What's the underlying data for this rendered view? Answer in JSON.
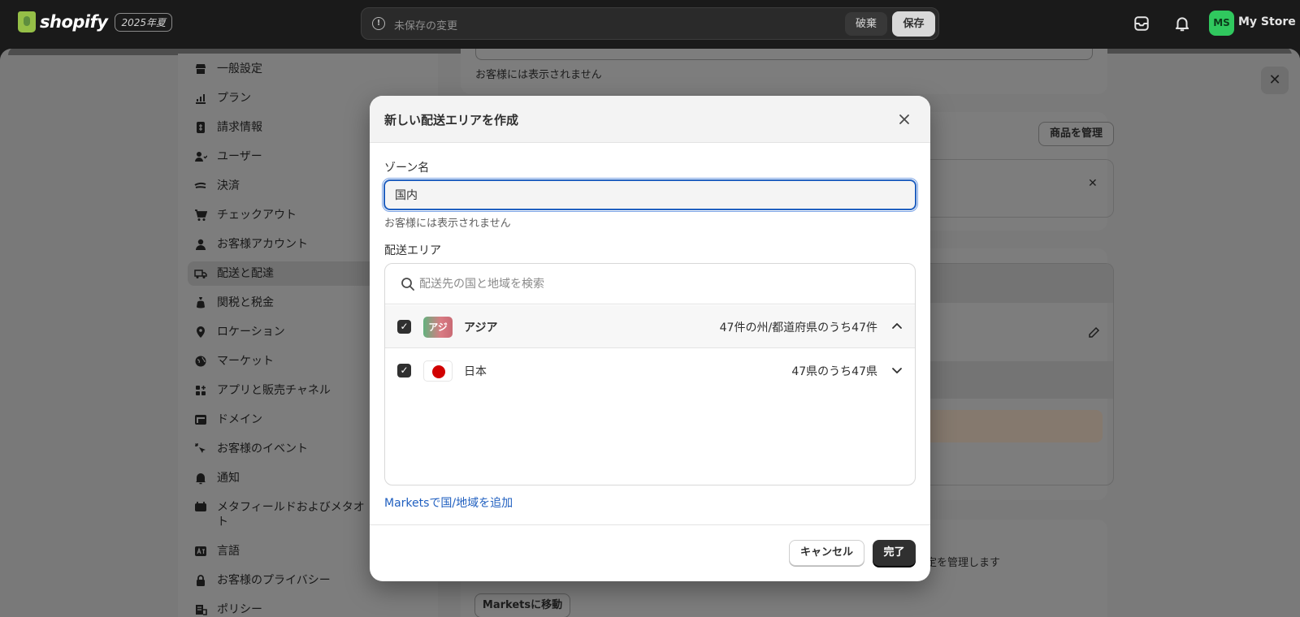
{
  "topbar": {
    "brand": "shopify",
    "season_badge": "2025年夏",
    "unsaved_text": "未保存の変更",
    "discard_label": "破棄",
    "save_label": "保存",
    "avatar_initials": "MS",
    "store_name": "My Store",
    "icons": [
      "shopify-logo-icon",
      "warning-icon",
      "inbox-icon",
      "bell-icon"
    ]
  },
  "sidebar": {
    "items": [
      {
        "label": "一般設定",
        "icon": "store-icon"
      },
      {
        "label": "プラン",
        "icon": "plan-icon"
      },
      {
        "label": "請求情報",
        "icon": "billing-icon"
      },
      {
        "label": "ユーザー",
        "icon": "users-icon"
      },
      {
        "label": "決済",
        "icon": "payments-icon"
      },
      {
        "label": "チェックアウト",
        "icon": "cart-icon"
      },
      {
        "label": "お客様アカウント",
        "icon": "person-icon"
      },
      {
        "label": "配送と配達",
        "icon": "truck-icon",
        "active": true
      },
      {
        "label": "関税と税金",
        "icon": "money-bag-icon"
      },
      {
        "label": "ロケーション",
        "icon": "location-pin-icon"
      },
      {
        "label": "マーケット",
        "icon": "globe-icon"
      },
      {
        "label": "アプリと販売チャネル",
        "icon": "apps-icon"
      },
      {
        "label": "ドメイン",
        "icon": "domain-icon"
      },
      {
        "label": "お客様のイベント",
        "icon": "events-icon"
      },
      {
        "label": "通知",
        "icon": "bell-icon"
      },
      {
        "label": "メタフィールドおよびメタオブジェクト",
        "label_line1": "メタフィールドおよびメタオ",
        "label_line2": "ト",
        "icon": "metafields-icon"
      },
      {
        "label": "言語",
        "icon": "language-icon"
      },
      {
        "label": "お客様のプライバシー",
        "icon": "lock-icon"
      },
      {
        "label": "ポリシー",
        "icon": "policy-icon"
      }
    ]
  },
  "background": {
    "help_text": "お客様には表示されません",
    "manage_products": "商品を管理",
    "markets_help_partial": "設定を管理します",
    "move_to_markets": "Marketsに移動"
  },
  "modal": {
    "title": "新しい配送エリアを作成",
    "zone_label": "ゾーン名",
    "zone_value": "国内",
    "zone_help": "お客様には表示されません",
    "area_label": "配送エリア",
    "search_placeholder": "配送先の国と地域を検索",
    "regions": [
      {
        "badge": "アジ",
        "name": "アジア",
        "count": "47件の州/都道府県のうち47件",
        "checked": true,
        "expanded": true
      },
      {
        "name": "日本",
        "count": "47県のうち47県",
        "checked": true,
        "expanded": false
      }
    ],
    "add_link": "Marketsで国/地域を追加",
    "cancel_label": "キャンセル",
    "done_label": "完了"
  },
  "colors": {
    "accent": "#2160c0",
    "avatar": "#30c85e",
    "primary_button": "#303030"
  }
}
